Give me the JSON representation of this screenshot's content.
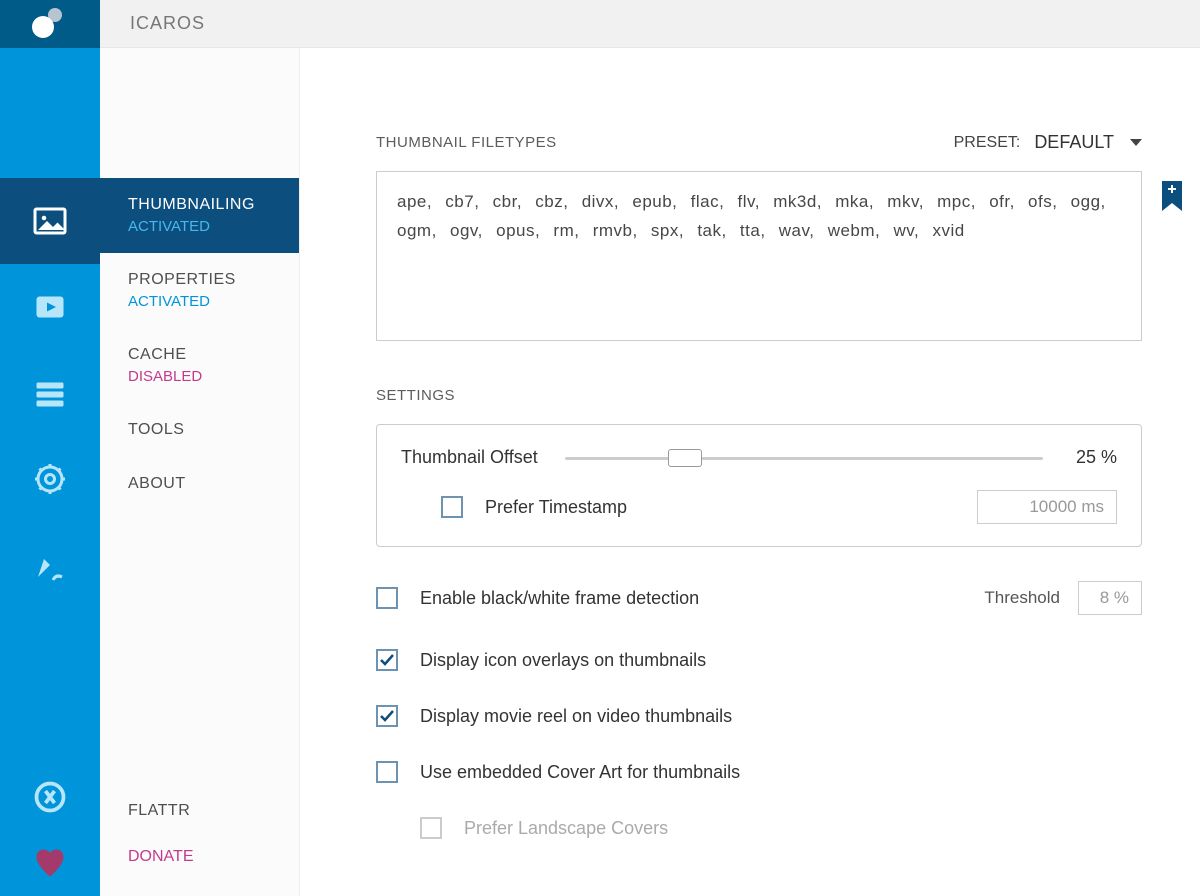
{
  "app_title": "ICAROS",
  "sidebar": {
    "items": [
      {
        "title": "THUMBNAILING",
        "status": "ACTIVATED",
        "status_class": "activated",
        "active": true
      },
      {
        "title": "PROPERTIES",
        "status": "ACTIVATED",
        "status_class": "activated",
        "active": false
      },
      {
        "title": "CACHE",
        "status": "DISABLED",
        "status_class": "disabled",
        "active": false
      },
      {
        "title": "TOOLS",
        "status": "",
        "status_class": "",
        "active": false
      },
      {
        "title": "ABOUT",
        "status": "",
        "status_class": "",
        "active": false
      }
    ],
    "flattr": "FLATTR",
    "donate": "DONATE"
  },
  "content": {
    "filetypes_heading": "THUMBNAIL FILETYPES",
    "preset_label": "PRESET:",
    "preset_value": "DEFAULT",
    "filetypes_text": "ape, cb7, cbr, cbz, divx, epub, flac, flv, mk3d, mka, mkv, mpc, ofr, ofs, ogg, ogm, ogv, opus, rm, rmvb, spx, tak, tta, wav, webm, wv, xvid",
    "settings_heading": "SETTINGS",
    "offset": {
      "label": "Thumbnail Offset",
      "percent": 25,
      "value_text": "25 %",
      "timestamp_label": "Prefer Timestamp",
      "timestamp_value": "10000 ms",
      "timestamp_checked": false
    },
    "threshold": {
      "label": "Threshold",
      "value": "8 %"
    },
    "checks": [
      {
        "label": "Enable black/white frame detection",
        "checked": false,
        "has_threshold": true
      },
      {
        "label": "Display icon overlays on thumbnails",
        "checked": true
      },
      {
        "label": "Display movie reel on video thumbnails",
        "checked": true
      },
      {
        "label": "Use embedded Cover Art for thumbnails",
        "checked": false
      },
      {
        "label": "Prefer Landscape Covers",
        "checked": false,
        "disabled": true,
        "indent": true
      }
    ]
  }
}
